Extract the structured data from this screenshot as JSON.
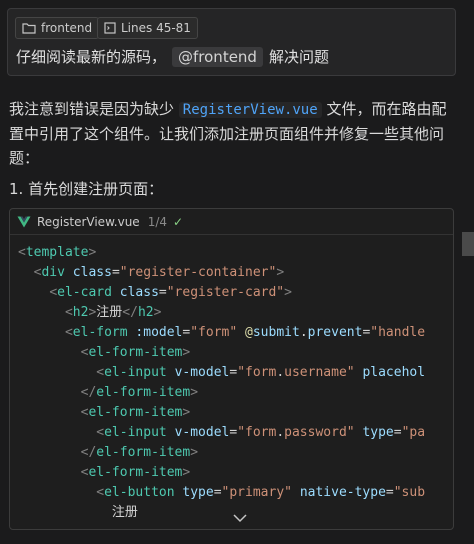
{
  "user_message": {
    "chips": {
      "frontend": "frontend",
      "lines": "Lines 45-81"
    },
    "text_before": "仔细阅读最新的源码，",
    "mention": "@frontend",
    "text_after": "解决问题"
  },
  "response": {
    "intro_part1": "我注意到错误是因为缺少",
    "intro_code": "RegisterView.vue",
    "intro_part2": "文件，而在路由配置中引用了这个组件。让我们添加注册页面组件并修复一些其他问题：",
    "step1": "1. 首先创建注册页面："
  },
  "code_block": {
    "filename": "RegisterView.vue",
    "count": "1/4",
    "check_icon": "✓",
    "lines": [
      [
        [
          "b",
          "<"
        ],
        [
          "t",
          "template"
        ],
        [
          "b",
          ">"
        ]
      ],
      [
        [
          "x",
          "  "
        ],
        [
          "b",
          "<"
        ],
        [
          "t",
          "div"
        ],
        [
          "x",
          " "
        ],
        [
          "a",
          "class"
        ],
        [
          "x",
          "="
        ],
        [
          "s",
          "\"register-container\""
        ],
        [
          "b",
          ">"
        ]
      ],
      [
        [
          "x",
          "    "
        ],
        [
          "b",
          "<"
        ],
        [
          "t",
          "el-card"
        ],
        [
          "x",
          " "
        ],
        [
          "a",
          "class"
        ],
        [
          "x",
          "="
        ],
        [
          "s",
          "\"register-card\""
        ],
        [
          "b",
          ">"
        ]
      ],
      [
        [
          "x",
          "      "
        ],
        [
          "b",
          "<"
        ],
        [
          "t",
          "h2"
        ],
        [
          "b",
          ">"
        ],
        [
          "x",
          "注册"
        ],
        [
          "b",
          "</"
        ],
        [
          "t",
          "h2"
        ],
        [
          "b",
          ">"
        ]
      ],
      [
        [
          "x",
          "      "
        ],
        [
          "b",
          "<"
        ],
        [
          "t",
          "el-form"
        ],
        [
          "x",
          " "
        ],
        [
          "a",
          ":model"
        ],
        [
          "x",
          "="
        ],
        [
          "s",
          "\"form\""
        ],
        [
          "x",
          " "
        ],
        [
          "y",
          "@"
        ],
        [
          "a",
          "submit"
        ],
        [
          "x",
          "."
        ],
        [
          "a",
          "prevent"
        ],
        [
          "x",
          "="
        ],
        [
          "s",
          "\"handle"
        ]
      ],
      [
        [
          "x",
          "        "
        ],
        [
          "b",
          "<"
        ],
        [
          "t",
          "el-form-item"
        ],
        [
          "b",
          ">"
        ]
      ],
      [
        [
          "x",
          "          "
        ],
        [
          "b",
          "<"
        ],
        [
          "t",
          "el-input"
        ],
        [
          "x",
          " "
        ],
        [
          "a",
          "v-model"
        ],
        [
          "x",
          "="
        ],
        [
          "s",
          "\"form"
        ],
        [
          "x",
          "."
        ],
        [
          "s",
          "username\""
        ],
        [
          "x",
          " "
        ],
        [
          "a",
          "placehol"
        ]
      ],
      [
        [
          "x",
          "        "
        ],
        [
          "b",
          "</"
        ],
        [
          "t",
          "el-form-item"
        ],
        [
          "b",
          ">"
        ]
      ],
      [
        [
          "x",
          "        "
        ],
        [
          "b",
          "<"
        ],
        [
          "t",
          "el-form-item"
        ],
        [
          "b",
          ">"
        ]
      ],
      [
        [
          "x",
          "          "
        ],
        [
          "b",
          "<"
        ],
        [
          "t",
          "el-input"
        ],
        [
          "x",
          " "
        ],
        [
          "a",
          "v-model"
        ],
        [
          "x",
          "="
        ],
        [
          "s",
          "\"form"
        ],
        [
          "x",
          "."
        ],
        [
          "s",
          "password\""
        ],
        [
          "x",
          " "
        ],
        [
          "a",
          "type"
        ],
        [
          "x",
          "="
        ],
        [
          "s",
          "\"pa"
        ]
      ],
      [
        [
          "x",
          "        "
        ],
        [
          "b",
          "</"
        ],
        [
          "t",
          "el-form-item"
        ],
        [
          "b",
          ">"
        ]
      ],
      [
        [
          "x",
          "        "
        ],
        [
          "b",
          "<"
        ],
        [
          "t",
          "el-form-item"
        ],
        [
          "b",
          ">"
        ]
      ],
      [
        [
          "x",
          "          "
        ],
        [
          "b",
          "<"
        ],
        [
          "t",
          "el-button"
        ],
        [
          "x",
          " "
        ],
        [
          "a",
          "type"
        ],
        [
          "x",
          "="
        ],
        [
          "s",
          "\"primary\""
        ],
        [
          "x",
          " "
        ],
        [
          "a",
          "native-type"
        ],
        [
          "x",
          "="
        ],
        [
          "s",
          "\"sub"
        ]
      ],
      [
        [
          "x",
          "            注册"
        ]
      ]
    ]
  },
  "icons": {
    "folder": "folder-icon",
    "file": "file-code-icon",
    "vue": "vue-icon",
    "chevron": "chevron-down-icon"
  }
}
